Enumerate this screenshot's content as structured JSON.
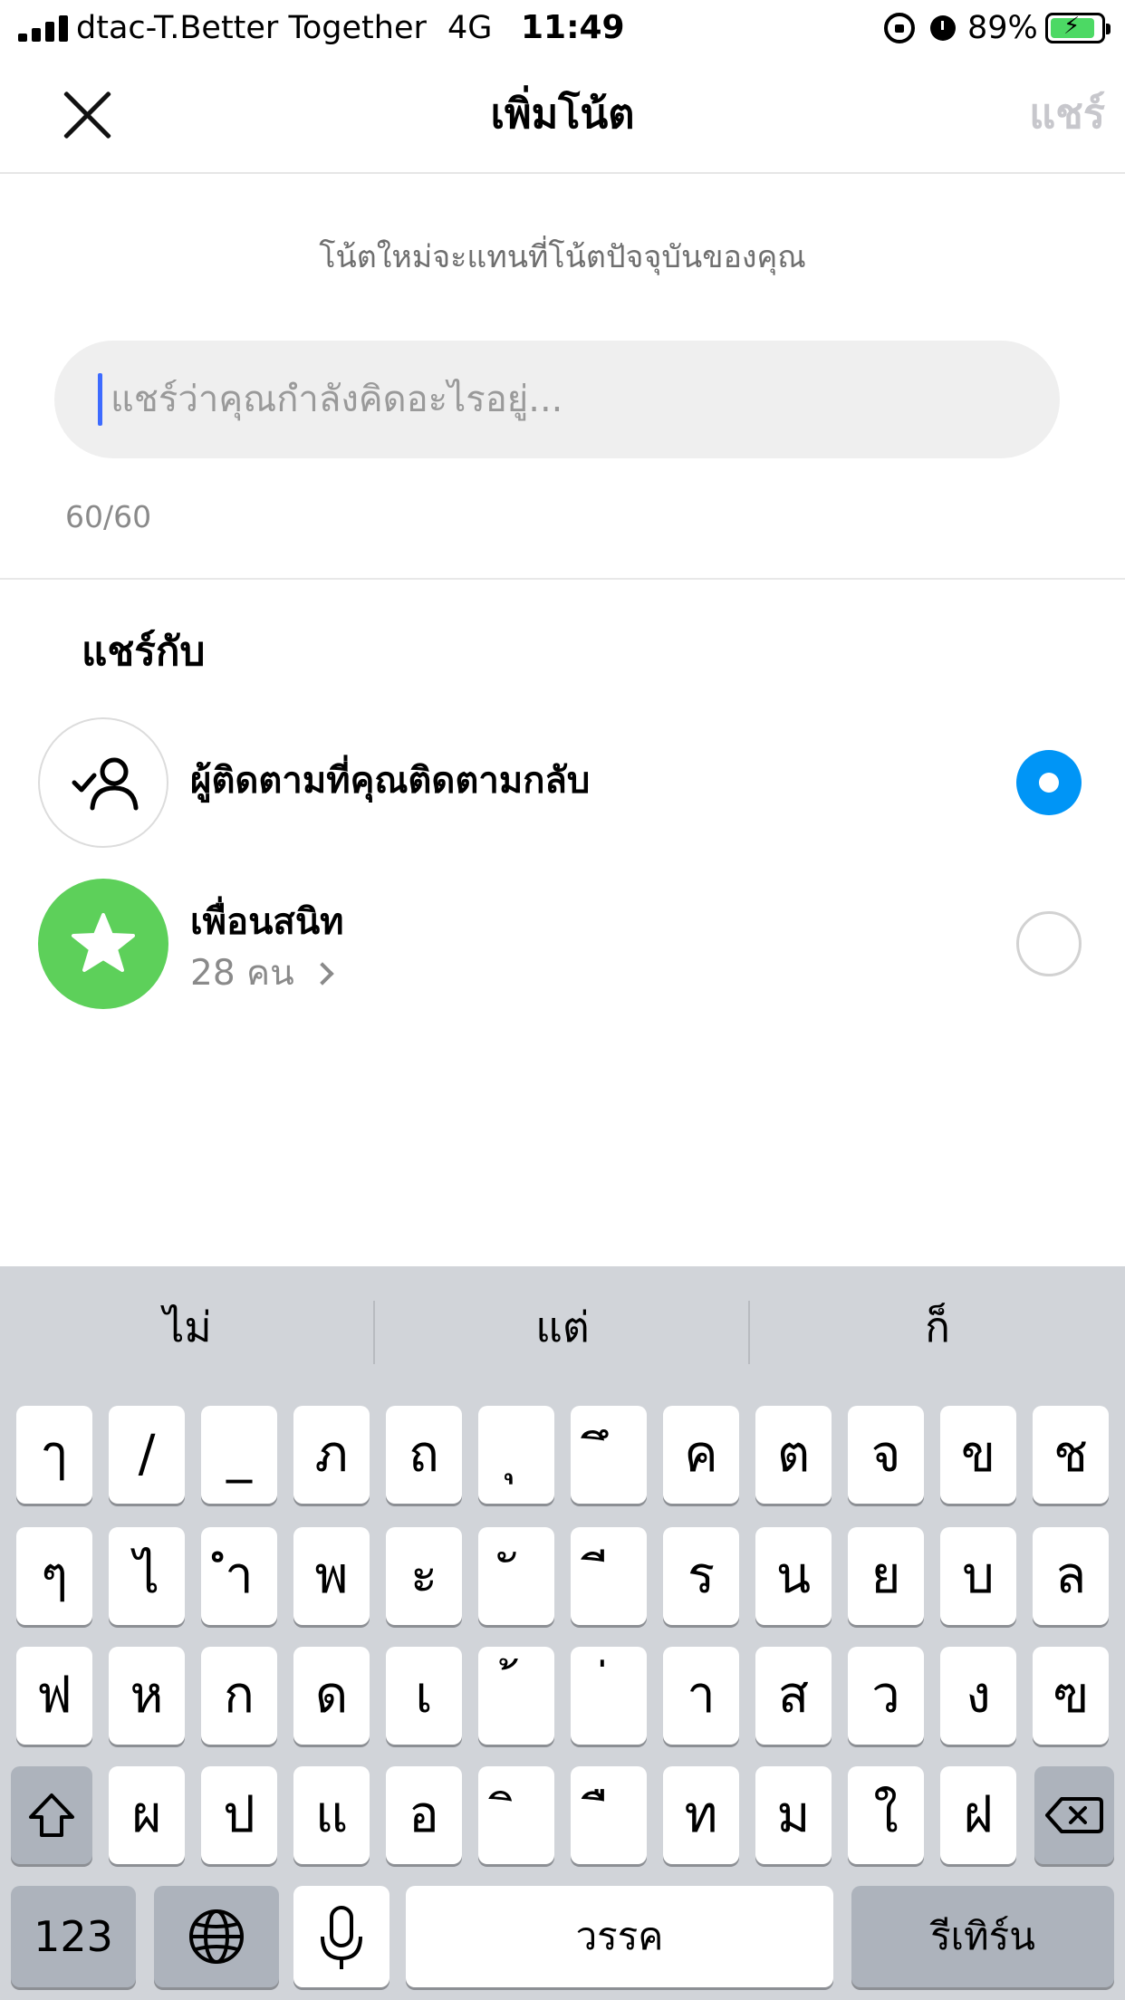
{
  "status_bar": {
    "carrier": "dtac-T.Better Together",
    "network": "4G",
    "time": "11:49",
    "battery_percent": "89%",
    "battery_level": 0.89,
    "battery_charging": true,
    "icons": [
      "signal-icon",
      "orientation-lock-icon",
      "alarm-icon",
      "battery-icon"
    ]
  },
  "nav": {
    "title": "เพิ่มโน้ต",
    "share_label": "แชร์",
    "close_icon": "close-icon"
  },
  "note": {
    "hint": "โน้ตใหม่จะแทนที่โน้ตปัจจุบันของคุณ",
    "placeholder": "แชร์ว่าคุณกำลังคิดอะไรอยู่...",
    "value": "",
    "counter": "60/60"
  },
  "share_with": {
    "title": "แชร์กับ",
    "options": [
      {
        "label": "ผู้ติดตามที่คุณติดตามกลับ",
        "icon": "followers-check-icon",
        "selected": true
      },
      {
        "label": "เพื่อนสนิท",
        "sublabel": "28 คน",
        "icon": "star-icon",
        "selected": false
      }
    ]
  },
  "colors": {
    "accent": "#0095f6",
    "close_friends": "#5dd05a",
    "disabled_text": "#c7c7cc",
    "keyboard_bg": "#d1d4d9"
  },
  "keyboard": {
    "suggestions": [
      "ไม่",
      "แต่",
      "ก็"
    ],
    "row1": [
      "ๅ",
      "/",
      "_",
      "ภ",
      "ถ",
      "ุ",
      "ึ",
      "ค",
      "ต",
      "จ",
      "ข",
      "ช"
    ],
    "row2": [
      "ๆ",
      "ไ",
      "ำ",
      "พ",
      "ะ",
      "ั",
      "ี",
      "ร",
      "น",
      "ย",
      "บ",
      "ล"
    ],
    "row3": [
      "ฟ",
      "ห",
      "ก",
      "ด",
      "เ",
      "้",
      "่",
      "า",
      "ส",
      "ว",
      "ง",
      "ฃ"
    ],
    "row4": [
      "ผ",
      "ป",
      "แ",
      "อ",
      "ิ",
      "ื",
      "ท",
      "ม",
      "ใ",
      "ฝ"
    ],
    "numbers_label": "123",
    "space_label": "วรรค",
    "return_label": "รีเทิร์น"
  }
}
